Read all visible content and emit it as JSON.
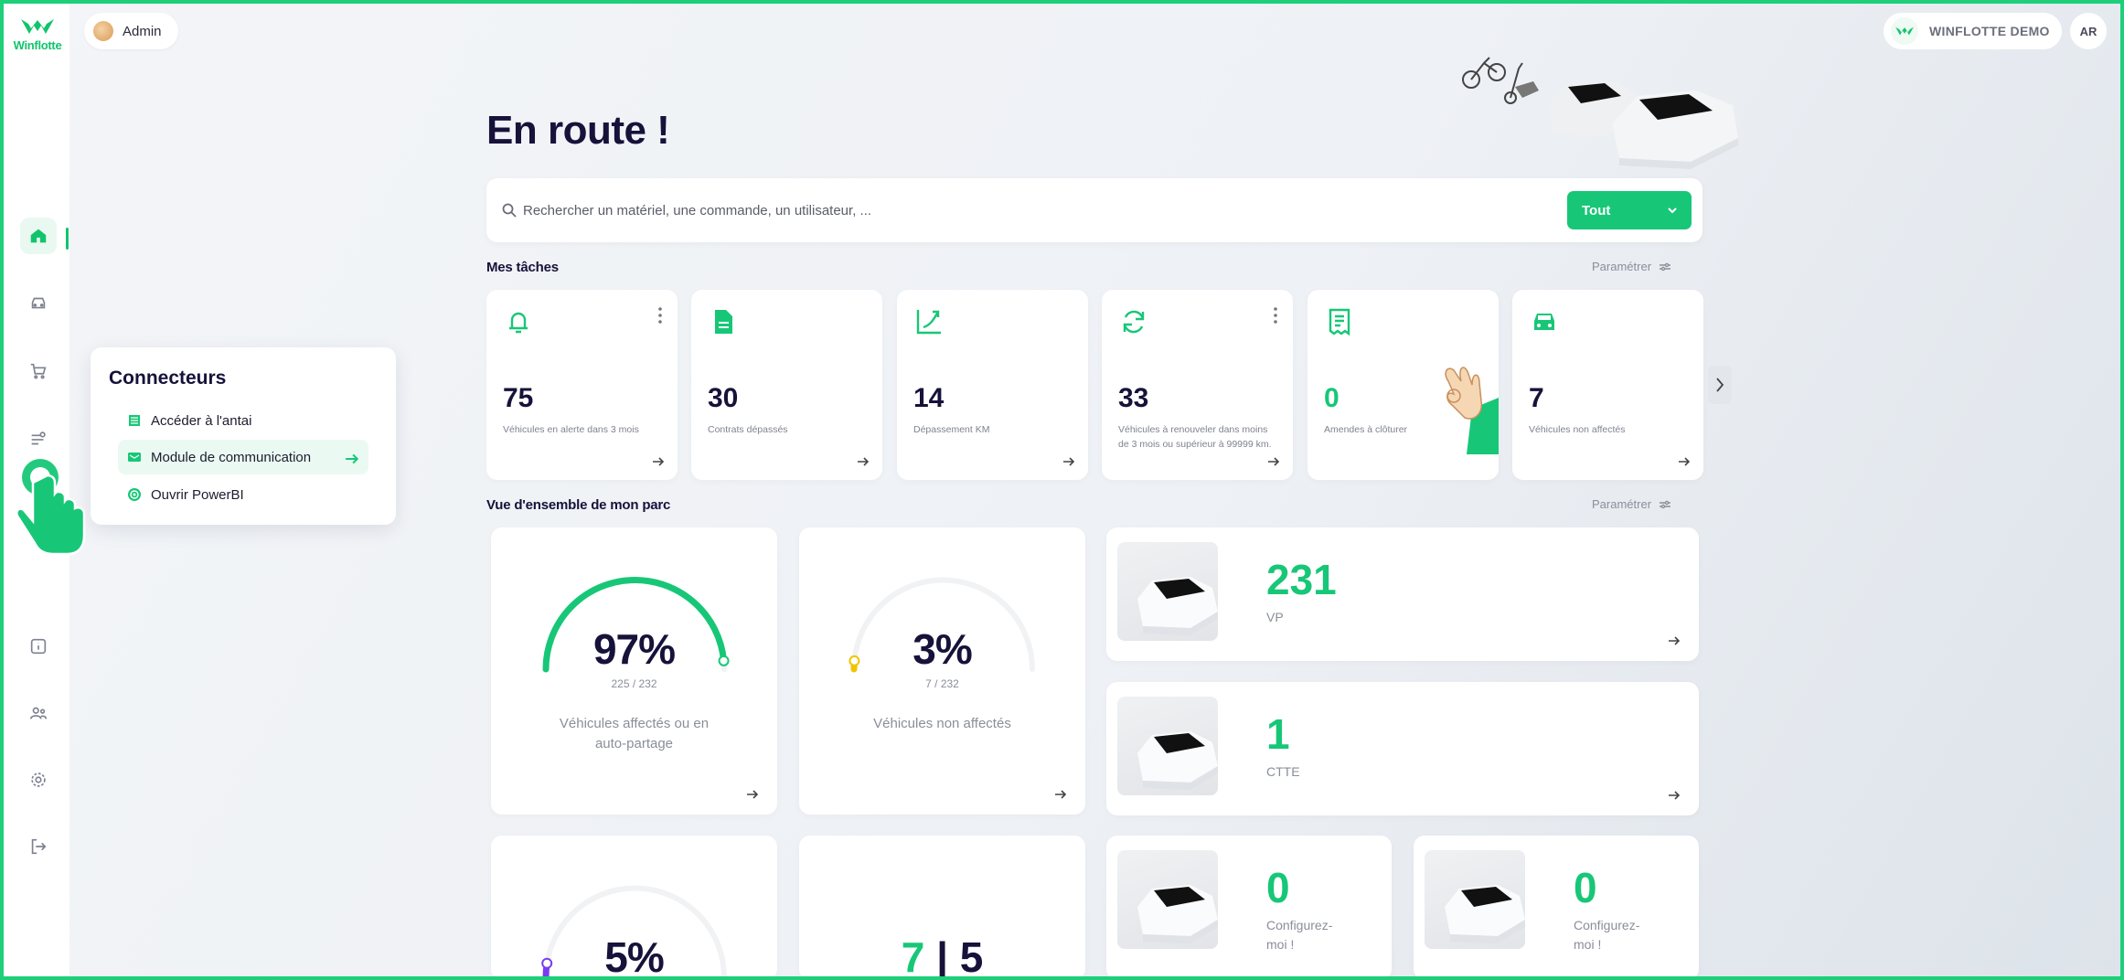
{
  "app": {
    "brand": "Winflotte",
    "user_name": "Admin",
    "company": "WINFLOTTE DEMO",
    "user_initials": "AR"
  },
  "sidebar": {
    "items": [
      {
        "name": "nav-home",
        "icon": "home-icon",
        "active": true
      },
      {
        "name": "nav-vehicles",
        "icon": "car-icon"
      },
      {
        "name": "nav-orders",
        "icon": "cart-icon"
      },
      {
        "name": "nav-connectors",
        "icon": "connector-icon"
      },
      {
        "name": "nav-info",
        "icon": "info-icon"
      },
      {
        "name": "nav-users",
        "icon": "users-icon"
      },
      {
        "name": "nav-settings",
        "icon": "gear-icon"
      },
      {
        "name": "nav-logout",
        "icon": "logout-icon"
      }
    ]
  },
  "page": {
    "title": "En route !"
  },
  "search": {
    "placeholder": "Rechercher un matériel, une commande, un utilisateur, ...",
    "filter_value": "Tout"
  },
  "tasks": {
    "title": "Mes tâches",
    "config_label": "Paramétrer",
    "cards": [
      {
        "count": "75",
        "label": "Véhicules en alerte dans 3 mois",
        "icon": "bell-icon"
      },
      {
        "count": "30",
        "label": "Contrats dépassés",
        "icon": "document-icon"
      },
      {
        "count": "14",
        "label": "Dépassement KM",
        "icon": "trend-up-icon"
      },
      {
        "count": "33",
        "label": "Véhicules à renouveler dans moins de 3 mois ou supérieur à 99999 km.",
        "icon": "refresh-icon"
      },
      {
        "count": "0",
        "label": "Amendes à clôturer",
        "icon": "receipt-icon"
      },
      {
        "count": "7",
        "label": "Véhicules non affectés",
        "icon": "car-icon"
      }
    ]
  },
  "overview": {
    "title": "Vue d'ensemble de mon parc",
    "config_label": "Paramétrer",
    "gauges": [
      {
        "value": "97%",
        "sub": "225 / 232",
        "label": "Véhicules affectés ou en auto-partage",
        "fraction": 0.97,
        "color": "#17c777"
      },
      {
        "value": "3%",
        "sub": "7 / 232",
        "label": "Véhicules non affectés",
        "fraction": 0.03,
        "color": "#f0c400"
      },
      {
        "value": "5%",
        "fraction": 0.05,
        "color": "#7a3cf0"
      }
    ],
    "split": {
      "left": "7",
      "sep": "|",
      "right": "5"
    },
    "fleet": [
      {
        "count": "231",
        "label": "VP"
      },
      {
        "count": "1",
        "label": "CTTE"
      },
      {
        "count": "0",
        "label": "Configurez-moi !"
      },
      {
        "count": "0",
        "label": "Configurez-moi !"
      }
    ]
  },
  "connectors": {
    "title": "Connecteurs",
    "items": [
      {
        "label": "Accéder à l'antai",
        "icon": "building-icon"
      },
      {
        "label": "Module de communication",
        "icon": "message-icon"
      },
      {
        "label": "Ouvrir PowerBI",
        "icon": "powerbi-icon"
      }
    ]
  },
  "colors": {
    "accent": "#17c777",
    "text": "#16123a",
    "muted": "#8a8e99"
  }
}
